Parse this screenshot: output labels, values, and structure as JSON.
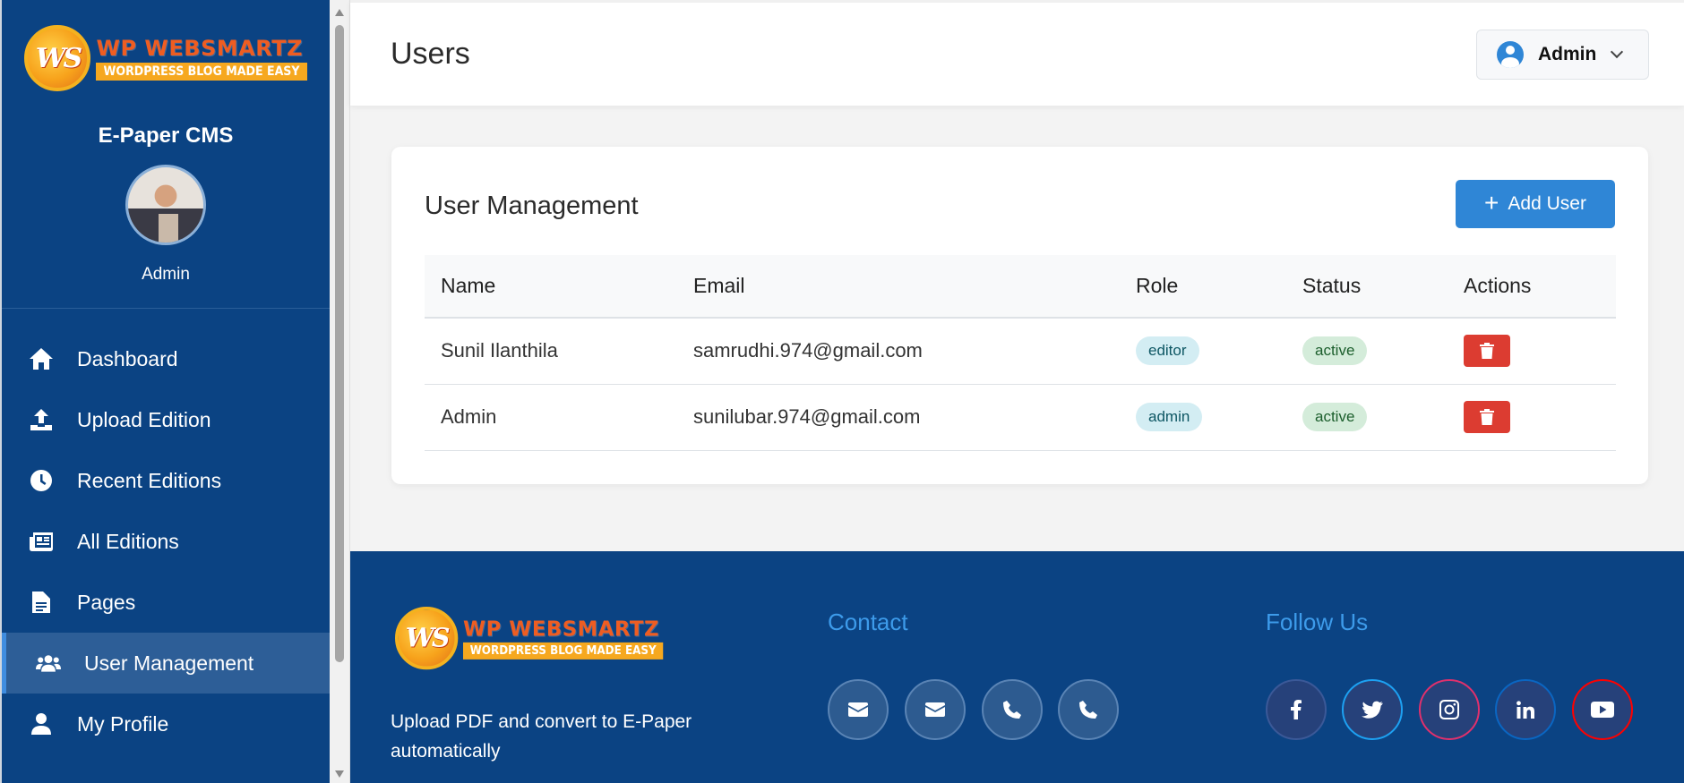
{
  "sidebar": {
    "logo_title": "WP WEBSMARTZ",
    "logo_sub": "WORDPRESS BLOG MADE EASY",
    "logo_mark": "WS",
    "app_name": "E-Paper CMS",
    "user_name": "Admin",
    "items": [
      {
        "label": "Dashboard",
        "icon": "home-icon"
      },
      {
        "label": "Upload Edition",
        "icon": "upload-icon"
      },
      {
        "label": "Recent Editions",
        "icon": "clock-icon"
      },
      {
        "label": "All Editions",
        "icon": "newspaper-icon"
      },
      {
        "label": "Pages",
        "icon": "file-icon"
      },
      {
        "label": "User Management",
        "icon": "users-icon",
        "active": true
      },
      {
        "label": "My Profile",
        "icon": "user-icon"
      }
    ]
  },
  "header": {
    "title": "Users",
    "user_menu_label": "Admin"
  },
  "card": {
    "title": "User Management",
    "add_button": "Add User",
    "columns": [
      "Name",
      "Email",
      "Role",
      "Status",
      "Actions"
    ],
    "rows": [
      {
        "name": "Sunil Ilanthila",
        "email": "samrudhi.974@gmail.com",
        "role": "editor",
        "status": "active"
      },
      {
        "name": "Admin",
        "email": "sunilubar.974@gmail.com",
        "role": "admin",
        "status": "active"
      }
    ]
  },
  "footer": {
    "logo_title": "WP WEBSMARTZ",
    "logo_sub": "WORDPRESS BLOG MADE EASY",
    "logo_mark": "WS",
    "tagline": "Upload PDF and convert to E-Paper automatically",
    "contact_heading": "Contact",
    "follow_heading": "Follow Us",
    "contact_icons": [
      "envelope-icon",
      "envelope-icon",
      "phone-icon",
      "phone-icon"
    ],
    "social_icons": [
      "facebook-icon",
      "twitter-icon",
      "instagram-icon",
      "linkedin-icon",
      "youtube-icon"
    ]
  },
  "colors": {
    "sidebar_bg": "#0b4383",
    "accent": "#2f86d6",
    "danger": "#dc3c31",
    "footer_heading": "#3d9bea"
  }
}
